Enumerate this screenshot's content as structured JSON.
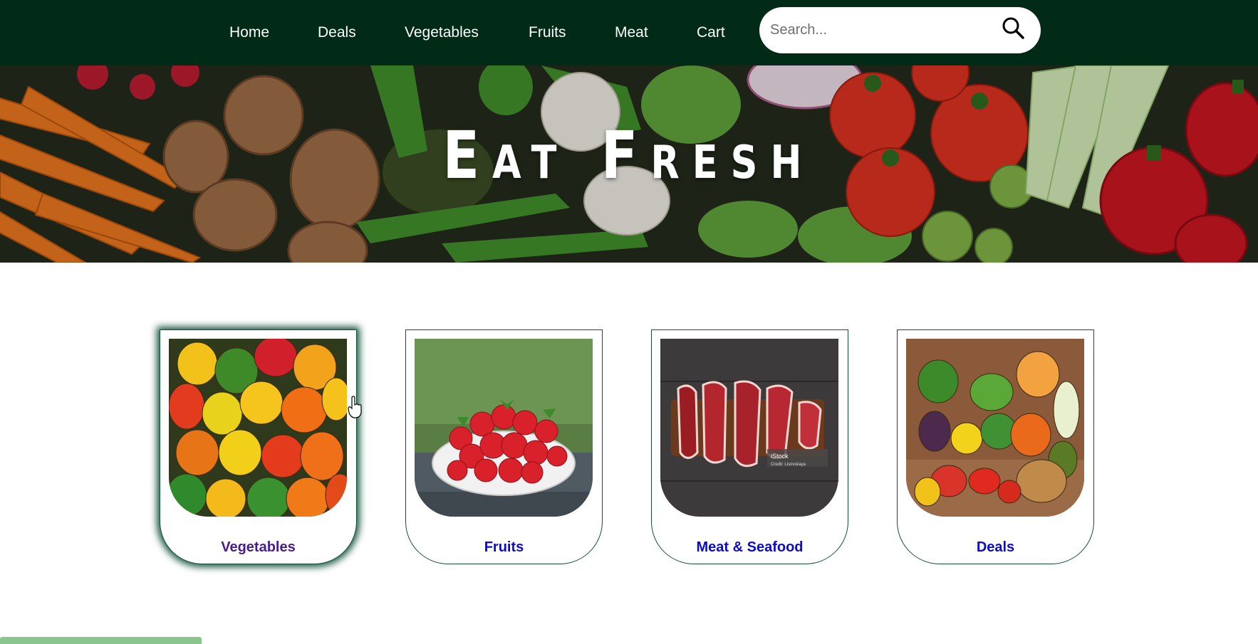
{
  "nav": {
    "items": [
      {
        "label": "Home"
      },
      {
        "label": "Deals"
      },
      {
        "label": "Vegetables"
      },
      {
        "label": "Fruits"
      },
      {
        "label": "Meat"
      },
      {
        "label": "Cart"
      }
    ]
  },
  "search": {
    "placeholder": "Search...",
    "value": "",
    "icon": "search-icon"
  },
  "hero": {
    "title": "Eat Fresh"
  },
  "categories": [
    {
      "label": "Vegetables",
      "visited": true
    },
    {
      "label": "Fruits",
      "visited": false
    },
    {
      "label": "Meat & Seafood",
      "visited": false
    },
    {
      "label": "Deals",
      "visited": false
    }
  ],
  "colors": {
    "navbar": "#012b16",
    "card_border": "#0f5132",
    "link": "#0b0bd0",
    "visited_link": "#4b1a8e"
  }
}
